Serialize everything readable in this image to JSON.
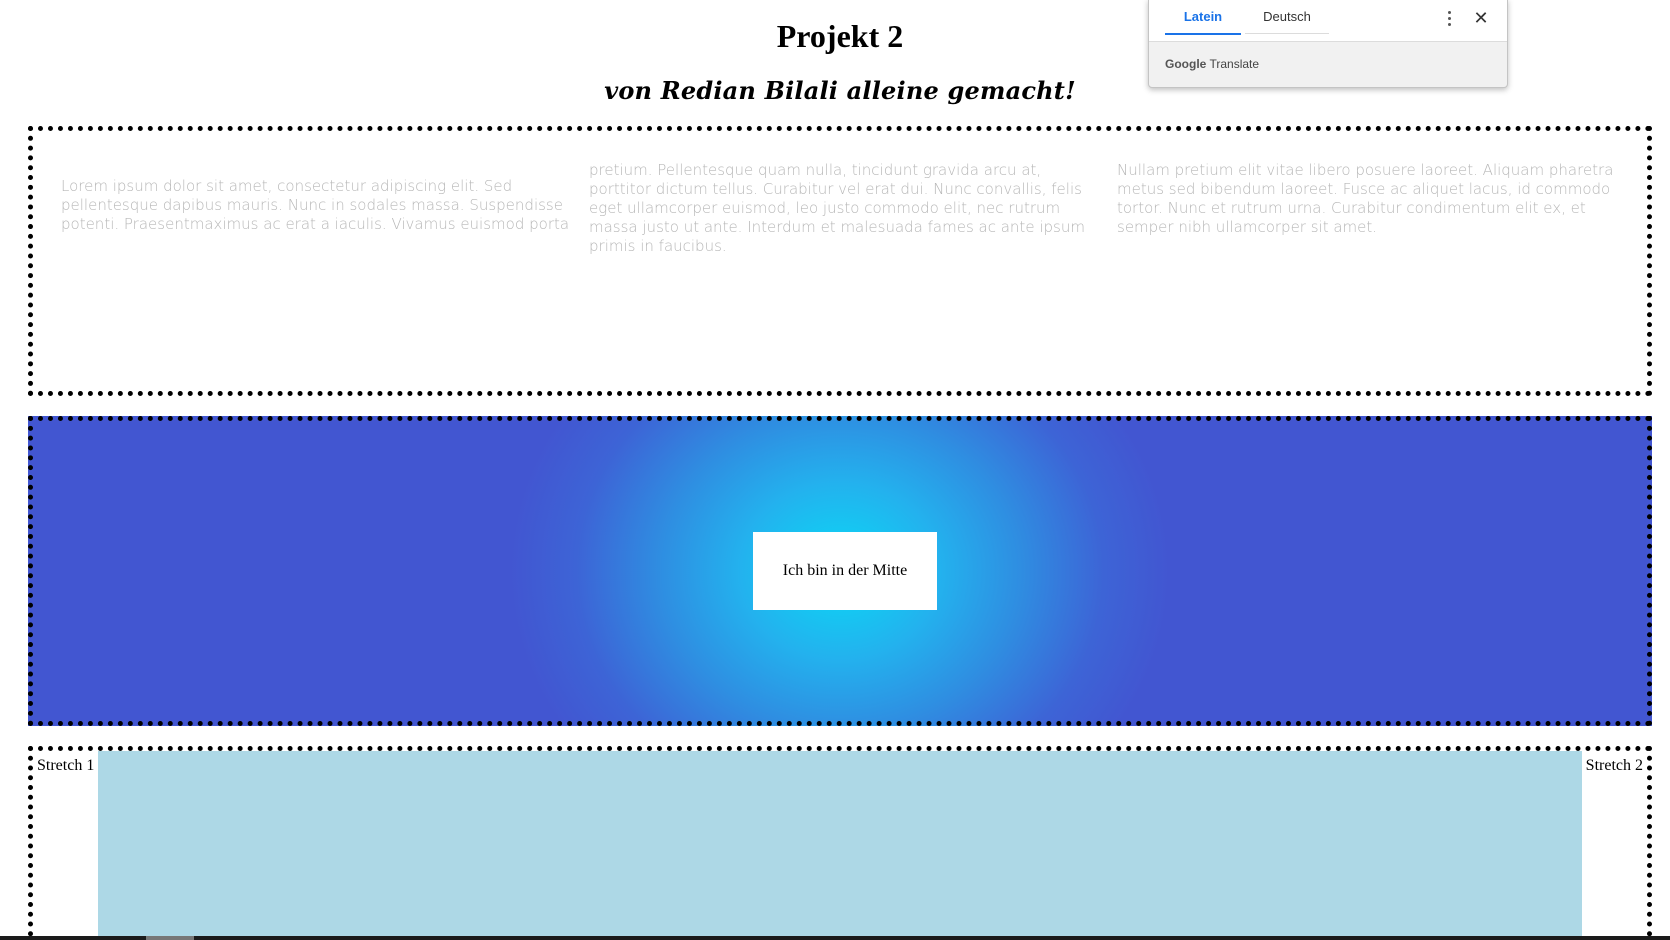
{
  "header": {
    "title": "Projekt 2",
    "subtitle": "von Redian Bilali alleine gemacht!"
  },
  "text_section": {
    "columns": [
      "Lorem ipsum dolor sit amet, consectetur adipiscing elit. Sed pellentesque dapibus mauris. Nunc in sodales massa. Suspendisse potenti. Praesentmaximus ac erat a iaculis. Vivamus euismod porta",
      "pretium. Pellentesque quam nulla, tincidunt gravida arcu at, porttitor dictum tellus. Curabitur vel erat dui. Nunc convallis, felis eget ullamcorper euismod, leo justo commodo elit, nec rutrum massa justo ut ante. Interdum et malesuada fames ac ante ipsum primis in faucibus.",
      "Nullam pretium elit vitae libero posuere laoreet. Aliquam pharetra metus sed bibendum laoreet. Fusce ac aliquet lacus, id commodo tortor. Nunc et rutrum urna. Curabitur condimentum elit ex, et semper nibh ullamcorper sit amet."
    ]
  },
  "center_section": {
    "label": "Ich bin in der Mitte",
    "colors": {
      "center": "#0ad9f5",
      "outer": "#4256d1"
    }
  },
  "stretch_section": {
    "left_label": "Stretch 1",
    "right_label": "Stretch 2",
    "middle_color": "#add8e6"
  },
  "translate_popup": {
    "tabs": [
      {
        "label": "Latein",
        "active": true
      },
      {
        "label": "Deutsch",
        "active": false
      }
    ],
    "more_icon": "more-vert-icon",
    "close_icon": "close-icon",
    "close_glyph": "✕",
    "brand_google": "Google",
    "brand_translate": "Translate",
    "accent": "#1a73e8"
  }
}
